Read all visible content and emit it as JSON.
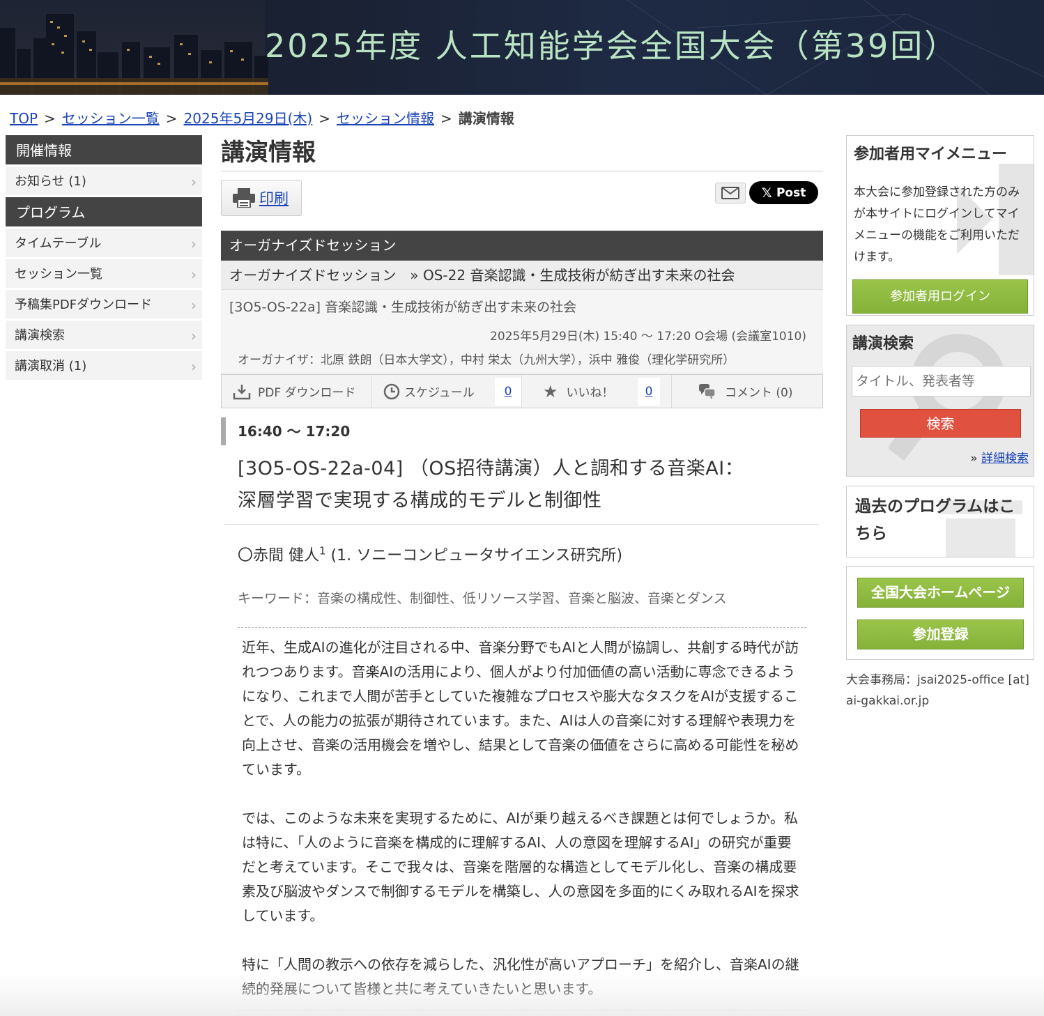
{
  "banner": {
    "title": "2025年度 人工知能学会全国大会（第39回）"
  },
  "breadcrumb": {
    "items": [
      "TOP",
      "セッション一覧",
      "2025年5月29日(木)",
      "セッション情報"
    ],
    "current": "講演情報",
    "separator": ">"
  },
  "left_nav": {
    "sections": [
      {
        "heading": "開催情報",
        "items": [
          "お知らせ (1)"
        ]
      },
      {
        "heading": "プログラム",
        "items": [
          "タイムテーブル",
          "セッション一覧",
          "予稿集PDFダウンロード",
          "講演検索",
          "講演取消 (1)"
        ]
      }
    ]
  },
  "main": {
    "title": "講演情報",
    "print_label": "印刷",
    "xpost_label": "Post",
    "session_header": "オーガナイズドセッション",
    "session_sub": "オーガナイズドセッション　» OS-22 音楽認識・生成技術が紡ぎ出す未来の社会",
    "session_code": "[3O5-OS-22a] 音楽認識・生成技術が紡ぎ出す未来の社会",
    "session_datetime": "2025年5月29日(木) 15:40 〜 17:20 O会場 (会議室1010)",
    "organizers": "オーガナイザ：北原 鉄朗（日本大学文），中村 栄太（九州大学），浜中 雅俊（理化学研究所）",
    "actions": {
      "pdf": "PDF ダウンロード",
      "schedule": "スケジュール",
      "schedule_count": "0",
      "like": "いいね！",
      "like_count": "0",
      "comment": "コメント (0)"
    },
    "time": "16:40 〜 17:20",
    "pres_title_line1": "[3O5-OS-22a-04] （OS招待講演）人と調和する音楽AI：",
    "pres_title_line2": "深層学習で実現する構成的モデルと制御性",
    "author_name": "〇赤間 健人",
    "author_sup": "1",
    "author_aff": " (1. ソニーコンピュータサイエンス研究所)",
    "keywords": "キーワード：音楽の構成性、制御性、低リソース学習、音楽と脳波、音楽とダンス",
    "abstract": [
      "近年、生成AIの進化が注目される中、音楽分野でもAIと人間が協調し、共創する時代が訪れつつあります。音楽AIの活用により、個人がより付加価値の高い活動に専念できるようになり、これまで人間が苦手としていた複雑なプロセスや膨大なタスクをAIが支援することで、人の能力の拡張が期待されています。また、AIは人の音楽に対する理解や表現力を向上させ、音楽の活用機会を増やし、結果として音楽の価値をさらに高める可能性を秘めています。",
      "では、このような未来を実現するために、AIが乗り越えるべき課題とは何でしょうか。私は特に、「人のように音楽を構成的に理解するAI、人の意図を理解するAI」の研究が重要だと考えています。そこで我々は、音楽を階層的な構造としてモデル化し、音楽の構成要素及び脳波やダンスで制御するモデルを構築し、人の意図を多面的にくみ取れるAIを探求しています。",
      "特に「人間の教示への依存を減らした、汎化性が高いアプローチ」を紹介し、音楽AIの継続的発展について皆様と共に考えていきたいと思います。"
    ]
  },
  "right": {
    "mymenu_title": "参加者用マイメニュー",
    "mymenu_desc": "本大会に参加登録された方のみが本サイトにログインしてマイメニューの機能をご利用いただけます。",
    "login_label": "参加者用ログイン",
    "search_title": "講演検索",
    "search_placeholder": "タイトル、発表者等",
    "search_button": "検索",
    "advanced_prefix": "»",
    "advanced_label": "詳細検索",
    "past_title": "過去のプログラムはこちら",
    "homepage_label": "全国大会ホームページ",
    "register_label": "参加登録",
    "office": "大会事務局：jsai2025-office [at] ai-gakkai.or.jp"
  },
  "colors": {
    "nav_dark": "#444444",
    "link": "#1a44b8",
    "green": "#8ab83e",
    "search_red": "#e05140"
  }
}
